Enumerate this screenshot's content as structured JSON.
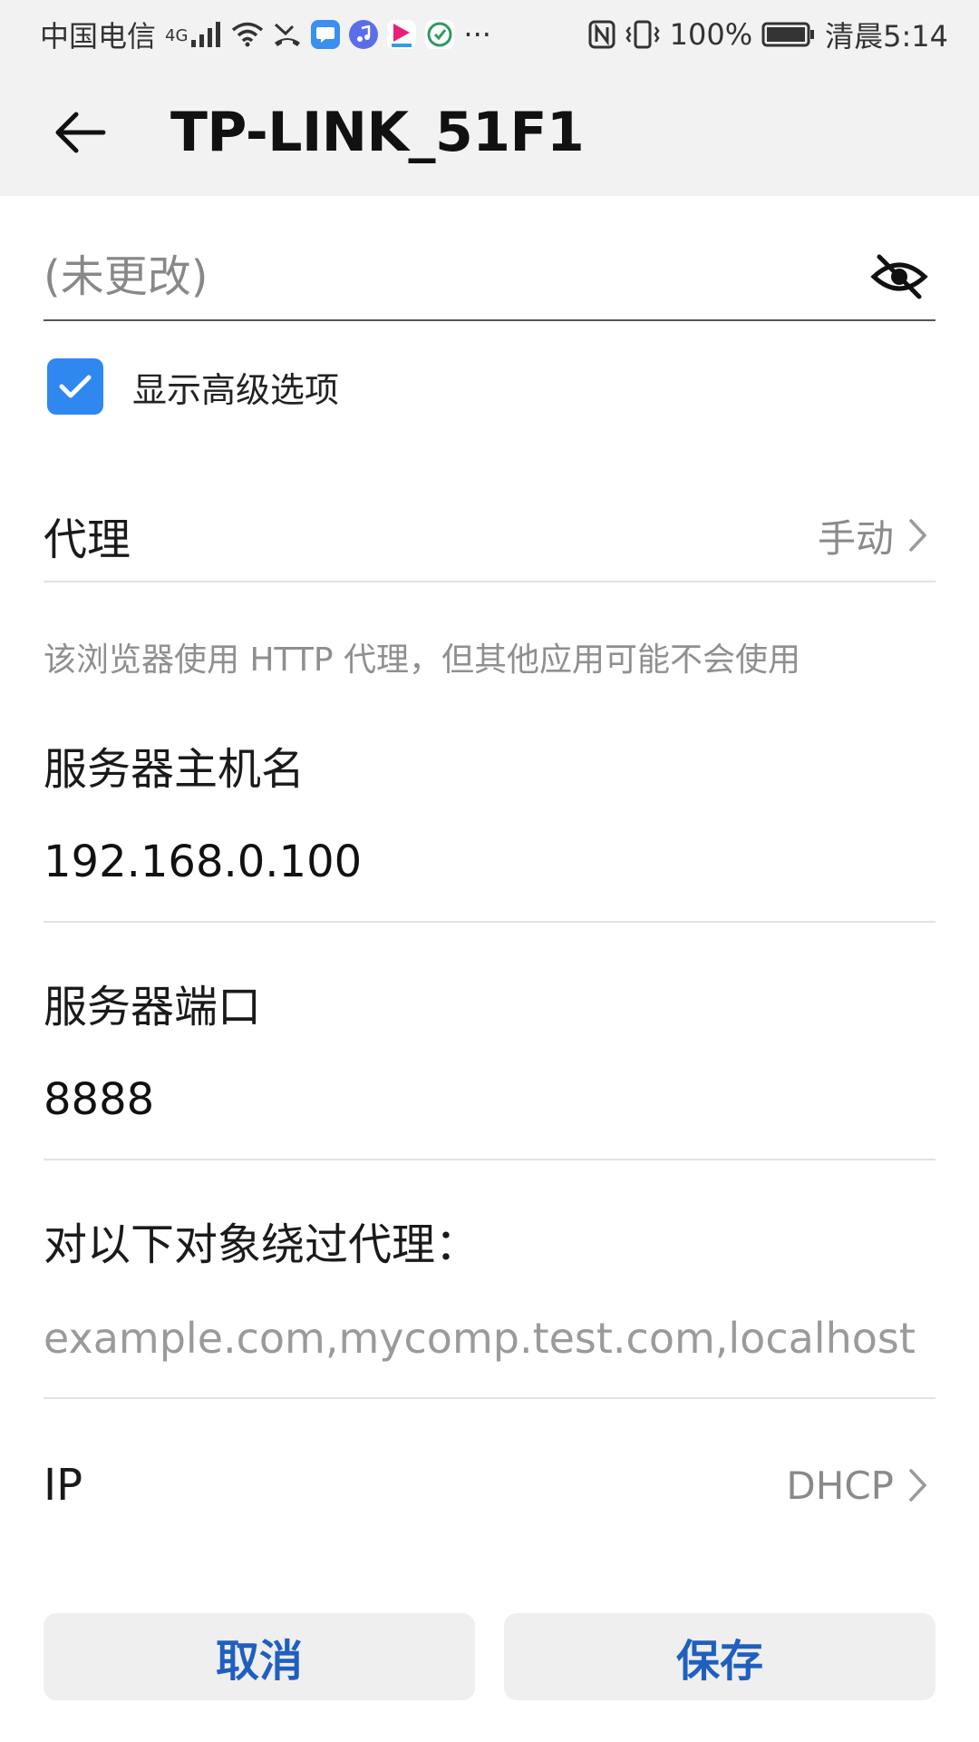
{
  "status_bar": {
    "carrier": "中国电信",
    "network": "4G",
    "more": "···",
    "battery": "100%",
    "time": "清晨5:14"
  },
  "app_bar": {
    "title": "TP-LINK_51F1"
  },
  "password": {
    "placeholder": "(未更改)"
  },
  "advanced": {
    "label": "显示高级选项",
    "checked": true
  },
  "proxy": {
    "label": "代理",
    "value": "手动",
    "note": "该浏览器使用 HTTP 代理，但其他应用可能不会使用"
  },
  "host": {
    "label": "服务器主机名",
    "value": "192.168.0.100"
  },
  "port": {
    "label": "服务器端口",
    "value": "8888"
  },
  "bypass": {
    "label": "对以下对象绕过代理：",
    "placeholder": "example.com,mycomp.test.com,localhost"
  },
  "ip": {
    "label": "IP",
    "value": "DHCP"
  },
  "buttons": {
    "cancel": "取消",
    "save": "保存"
  },
  "colors": {
    "accent": "#2f87f0",
    "button_text": "#1f5fbf"
  }
}
